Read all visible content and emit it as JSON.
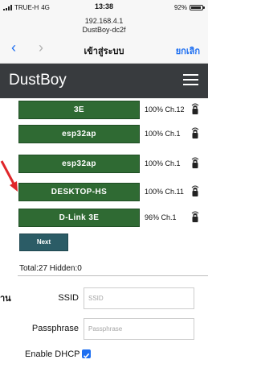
{
  "status_bar": {
    "carrier": "TRUE-H",
    "network": "4G",
    "time": "13:38",
    "battery": "92%",
    "battery_level": 0.92
  },
  "browser": {
    "address_ip": "192.168.4.1",
    "address_host": "DustBoy-dc2f",
    "back_icon": "chevron-left-icon",
    "forward_icon": "chevron-right-icon",
    "page_title": "เข้าสู่ระบบ",
    "cancel_label": "ยกเลิก"
  },
  "app": {
    "title": "DustBoy",
    "menu_icon": "hamburger-icon"
  },
  "networks": [
    {
      "ssid": "3E",
      "signal": "100%",
      "channel": "Ch.12"
    },
    {
      "ssid": "esp32ap",
      "signal": "100%",
      "channel": "Ch.1"
    },
    {
      "ssid": "esp32ap",
      "signal": "100%",
      "channel": "Ch.1"
    },
    {
      "ssid": "DESKTOP-HS",
      "signal": "100%",
      "channel": "Ch.11"
    },
    {
      "ssid": "D-Link 3E",
      "signal": "96%",
      "channel": "Ch.1"
    }
  ],
  "next_label": "Next",
  "total_text": "Total:27 Hidden:0",
  "side_text": "าน",
  "form": {
    "ssid_label": "SSID",
    "ssid_placeholder": "SSID",
    "passphrase_label": "Passphrase",
    "passphrase_placeholder": "Passphrase",
    "dhcp_label": "Enable DHCP",
    "dhcp_checked": true
  },
  "colors": {
    "network_button": "#2f6a33",
    "next_button": "#2b5c66",
    "app_header": "#383b3e",
    "ios_link": "#1e6ff1",
    "annotation_arrow": "#e0262a"
  }
}
